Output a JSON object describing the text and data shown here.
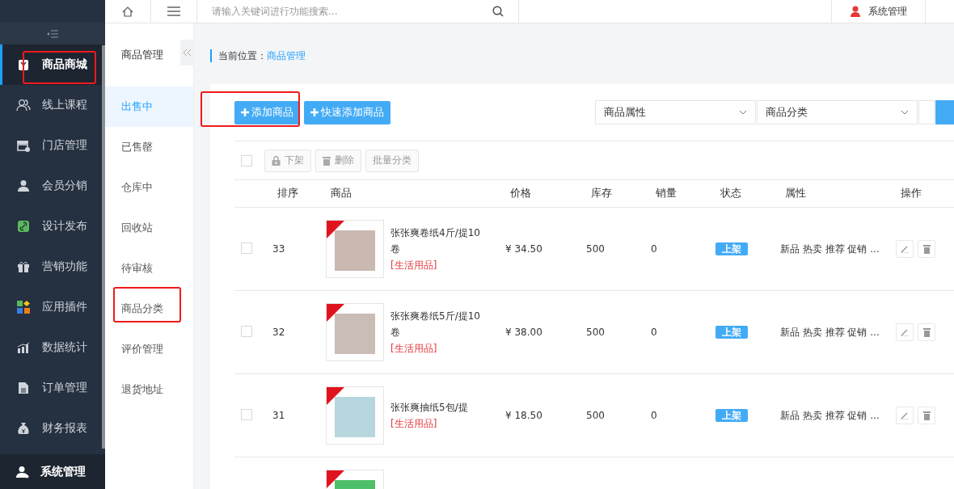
{
  "sidebar": {
    "items": [
      {
        "label": "商品商城",
        "selected": true,
        "annotated": true
      },
      {
        "label": "线上课程",
        "selected": false,
        "annotated": false
      },
      {
        "label": "门店管理",
        "selected": false,
        "annotated": false
      },
      {
        "label": "会员分销",
        "selected": false,
        "annotated": false
      },
      {
        "label": "设计发布",
        "selected": false,
        "annotated": false
      },
      {
        "label": "营销功能",
        "selected": false,
        "annotated": false
      },
      {
        "label": "应用插件",
        "selected": false,
        "annotated": false
      },
      {
        "label": "数据统计",
        "selected": false,
        "annotated": false
      },
      {
        "label": "订单管理",
        "selected": false,
        "annotated": false
      },
      {
        "label": "财务报表",
        "selected": false,
        "annotated": false
      }
    ],
    "footer": {
      "label": "系统管理"
    }
  },
  "top_bar": {
    "search": {
      "placeholder": "请输入关键词进行功能搜索..."
    },
    "user": "系统管理"
  },
  "sub_nav": {
    "title": "商品管理",
    "items": [
      {
        "label": "出售中",
        "selected": true,
        "annotated": false
      },
      {
        "label": "已售罄",
        "selected": false,
        "annotated": false
      },
      {
        "label": "仓库中",
        "selected": false,
        "annotated": false
      },
      {
        "label": "回收站",
        "selected": false,
        "annotated": false
      },
      {
        "label": "待审核",
        "selected": false,
        "annotated": false
      },
      {
        "label": "商品分类",
        "selected": false,
        "annotated": true
      },
      {
        "label": "评价管理",
        "selected": false,
        "annotated": false
      },
      {
        "label": "退货地址",
        "selected": false,
        "annotated": false
      }
    ]
  },
  "breadcrumb": {
    "label": "当前位置：",
    "link": "商品管理"
  },
  "toolbar": {
    "buttons": [
      {
        "label": "添加商品",
        "annotated": true
      },
      {
        "label": "快速添加商品",
        "annotated": false
      }
    ],
    "selects": [
      {
        "value": "商品属性"
      },
      {
        "value": "商品分类"
      }
    ]
  },
  "batch": {
    "checked": false,
    "buttons": [
      {
        "label": "下架",
        "kind": "lock"
      },
      {
        "label": "删除",
        "kind": "trash"
      },
      {
        "label": "批量分类",
        "kind": "plain"
      }
    ]
  },
  "table": {
    "columns": [
      "排序",
      "商品",
      "价格",
      "库存",
      "销量",
      "状态",
      "属性",
      "操作"
    ],
    "rows": [
      {
        "image": true,
        "checked": false,
        "sort": "33",
        "name": "张张爽卷纸4斤/提10卷",
        "category": "[生活用品]",
        "price": "¥ 34.50",
        "stock": "500",
        "sales": "0",
        "status": "上架",
        "attributes": "新品 热卖 推荐 促销 ..."
      },
      {
        "image": true,
        "checked": false,
        "sort": "32",
        "name": "张张爽卷纸5斤/提10卷",
        "category": "[生活用品]",
        "price": "¥ 38.00",
        "stock": "500",
        "sales": "0",
        "status": "上架",
        "attributes": "新品 热卖 推荐 促销 ..."
      },
      {
        "image": true,
        "checked": false,
        "sort": "31",
        "name": "张张爽抽纸5包/提",
        "category": "[生活用品]",
        "price": "¥ 18.50",
        "stock": "500",
        "sales": "0",
        "status": "上架",
        "attributes": "新品 热卖 推荐 促销 ..."
      },
      {
        "image": true
      }
    ]
  }
}
